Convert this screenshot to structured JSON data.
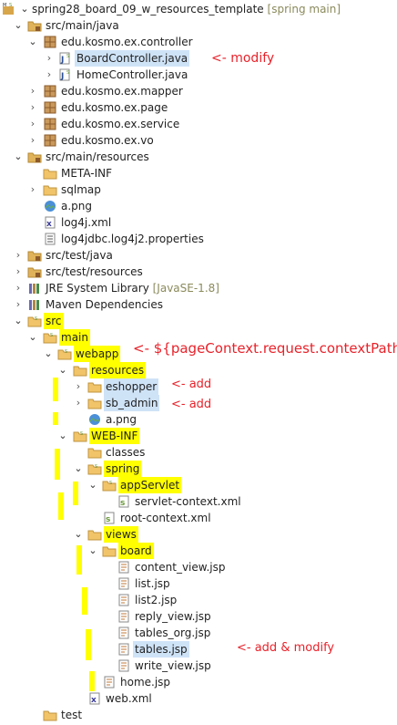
{
  "tree": {
    "root": "spring28_board_09_w_resources_template",
    "root_decoration": "[spring main]",
    "src_main_java": "src/main/java",
    "pkg_controller": "edu.kosmo.ex.controller",
    "board_controller": "BoardController.java",
    "home_controller": "HomeController.java",
    "pkg_mapper": "edu.kosmo.ex.mapper",
    "pkg_page": "edu.kosmo.ex.page",
    "pkg_service": "edu.kosmo.ex.service",
    "pkg_vo": "edu.kosmo.ex.vo",
    "src_main_resources": "src/main/resources",
    "meta_inf": "META-INF",
    "sqlmap": "sqlmap",
    "a_png": "a.png",
    "log4j_xml": "log4j.xml",
    "log4jdbc": "log4jdbc.log4j2.properties",
    "src_test_java": "src/test/java",
    "src_test_resources": "src/test/resources",
    "jre": "JRE System Library",
    "jre_decoration": "[JavaSE-1.8]",
    "maven": "Maven Dependencies",
    "src": "src",
    "main": "main",
    "webapp": "webapp",
    "resources": "resources",
    "eshopper": "eshopper",
    "sb_admin": "sb_admin",
    "a_png2": "a.png",
    "web_inf": "WEB-INF",
    "classes": "classes",
    "spring": "spring",
    "app_servlet": "appServlet",
    "servlet_context": "servlet-context.xml",
    "root_context": "root-context.xml",
    "views": "views",
    "board": "board",
    "content_view": "content_view.jsp",
    "list": "list.jsp",
    "list2": "list2.jsp",
    "reply_view": "reply_view.jsp",
    "tables_org": "tables_org.jsp",
    "tables": "tables.jsp",
    "write_view": "write_view.jsp",
    "home": "home.jsp",
    "web_xml": "web.xml",
    "test": "test"
  },
  "annotations": {
    "modify": "<- modify",
    "context_path": "<- ${pageContext.request.contextPath}",
    "add1": "<- add",
    "add2": "<- add",
    "add_modify": "<- add & modify"
  },
  "colors": {
    "highlight": "#ffff00",
    "selection": "#cfe3f7",
    "annotation": "#e8222a"
  }
}
